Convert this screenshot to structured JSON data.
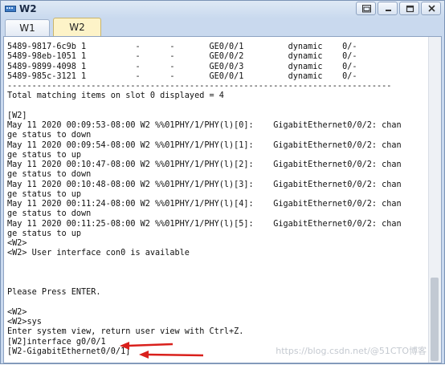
{
  "window": {
    "title": "W2"
  },
  "tabs": [
    {
      "label": "W1",
      "active": false
    },
    {
      "label": "W2",
      "active": true
    }
  ],
  "console": {
    "lines": [
      "5489-9817-6c9b 1          -      -       GE0/0/1         dynamic    0/-",
      "5489-98eb-1051 1          -      -       GE0/0/2         dynamic    0/-",
      "5489-9899-4098 1          -      -       GE0/0/3         dynamic    0/-",
      "5489-985c-3121 1          -      -       GE0/0/1         dynamic    0/-",
      "------------------------------------------------------------------------------",
      "Total matching items on slot 0 displayed = 4",
      "",
      "[W2]",
      "May 11 2020 00:09:53-08:00 W2 %%01PHY/1/PHY(l)[0]:    GigabitEthernet0/0/2: chan",
      "ge status to down",
      "May 11 2020 00:09:54-08:00 W2 %%01PHY/1/PHY(l)[1]:    GigabitEthernet0/0/2: chan",
      "ge status to up",
      "May 11 2020 00:10:47-08:00 W2 %%01PHY/1/PHY(l)[2]:    GigabitEthernet0/0/2: chan",
      "ge status to down",
      "May 11 2020 00:10:48-08:00 W2 %%01PHY/1/PHY(l)[3]:    GigabitEthernet0/0/2: chan",
      "ge status to up",
      "May 11 2020 00:11:24-08:00 W2 %%01PHY/1/PHY(l)[4]:    GigabitEthernet0/0/2: chan",
      "ge status to down",
      "May 11 2020 00:11:25-08:00 W2 %%01PHY/1/PHY(l)[5]:    GigabitEthernet0/0/2: chan",
      "ge status to up",
      "<W2>",
      "<W2> User interface con0 is available",
      "",
      "",
      "",
      "Please Press ENTER.",
      "",
      "<W2>",
      "<W2>sys",
      "Enter system view, return user view with Ctrl+Z.",
      "[W2]interface g0/0/1",
      "[W2-GigabitEthernet0/0/1]"
    ]
  },
  "watermark": "https://blog.csdn.net/@51CTO博客",
  "icons": {
    "app": "network-device-icon",
    "restore": "restore-icon",
    "minimize": "minimize-icon",
    "maximize": "maximize-icon",
    "close": "close-icon"
  },
  "colors": {
    "active_tab": "#fdf3c8",
    "annotation_arrow": "#d9201c",
    "title_bar": "#c9d9ee"
  }
}
